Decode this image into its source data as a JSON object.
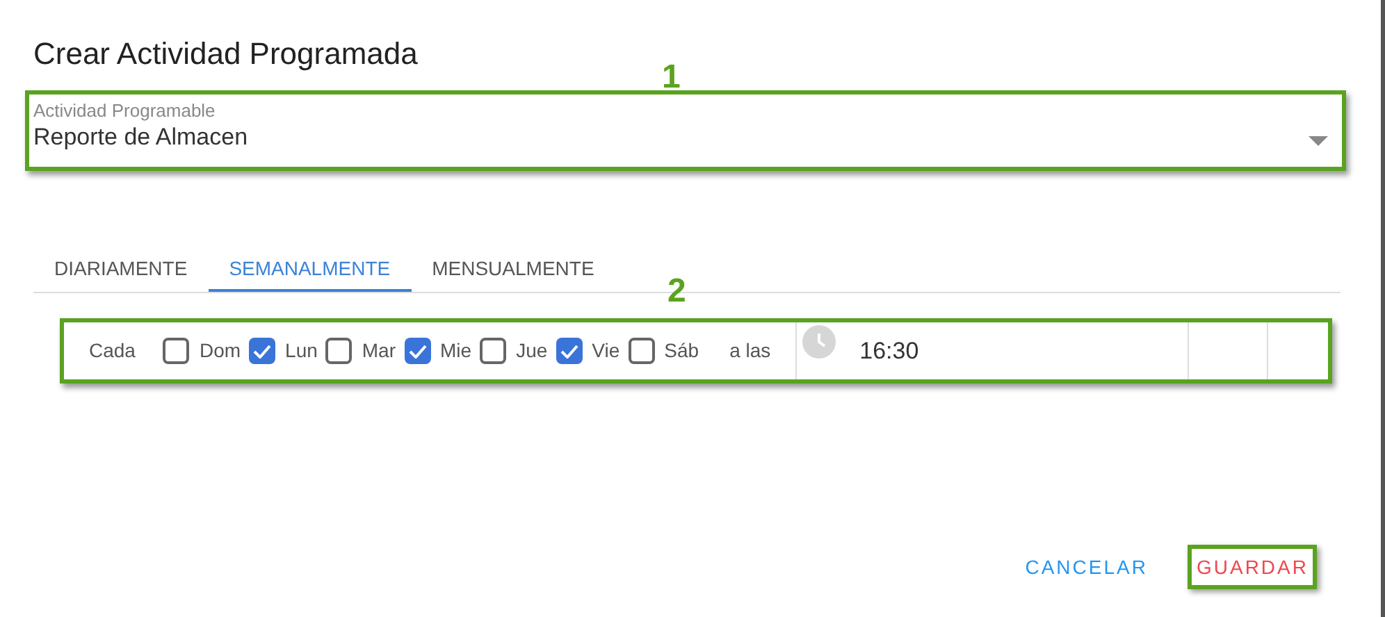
{
  "dialog": {
    "title": "Crear Actividad Programada"
  },
  "annotations": [
    "1",
    "2"
  ],
  "select": {
    "label": "Actividad Programable",
    "value": "Reporte de Almacen"
  },
  "tabs": [
    {
      "label": "DIARIAMENTE",
      "selected": false
    },
    {
      "label": "SEMANALMENTE",
      "selected": true
    },
    {
      "label": "MENSUALMENTE",
      "selected": false
    }
  ],
  "schedule": {
    "prefix": "Cada",
    "suffix": "a las",
    "time": "16:30",
    "days": [
      {
        "label": "Dom",
        "checked": false
      },
      {
        "label": "Lun",
        "checked": true
      },
      {
        "label": "Mar",
        "checked": false
      },
      {
        "label": "Mie",
        "checked": true
      },
      {
        "label": "Jue",
        "checked": false
      },
      {
        "label": "Vie",
        "checked": true
      },
      {
        "label": "Sáb",
        "checked": false
      }
    ]
  },
  "buttons": [
    {
      "label": "CANCELAR",
      "kind": "cancel"
    },
    {
      "label": "GUARDAR",
      "kind": "save"
    }
  ]
}
